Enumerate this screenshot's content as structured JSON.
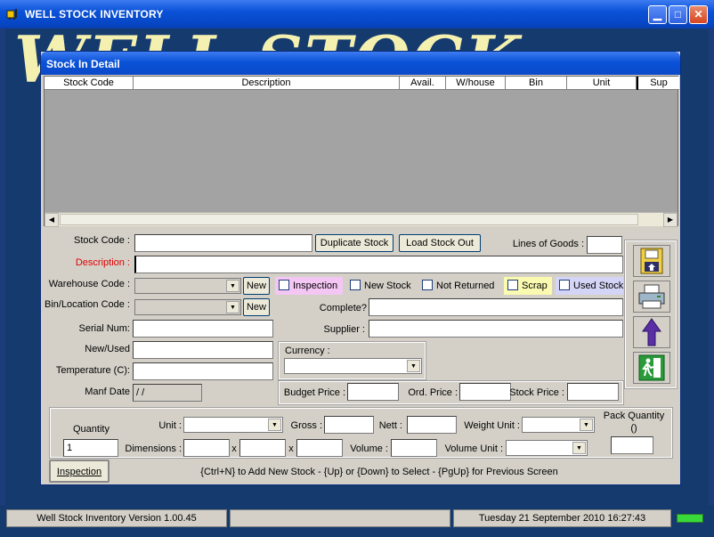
{
  "app": {
    "title": "WELL STOCK INVENTORY",
    "watermark": "WELL STOCK"
  },
  "window": {
    "title": "Stock In Detail"
  },
  "grid": {
    "columns": [
      "Stock Code",
      "Description",
      "Avail.",
      "W/house",
      "Bin",
      "Unit",
      "Sup"
    ]
  },
  "form": {
    "stock_code_label": "Stock Code :",
    "duplicate_stock_label": "Duplicate Stock",
    "load_stock_out_label": "Load Stock Out",
    "lines_of_goods_label": "Lines of Goods :",
    "description_label": "Description :",
    "warehouse_code_label": "Warehouse Code :",
    "new_label": "New",
    "bin_location_label": "Bin/Location Code :",
    "serial_num_label": "Serial Num:",
    "new_used_label": "New/Used",
    "temperature_label": "Temperature (C):",
    "manf_date_label": "Manf Date",
    "manf_date_value": " / /",
    "complete_label": "Complete?",
    "supplier_label": "Supplier :",
    "currency_label": "Currency :",
    "budget_price_label": "Budget Price :",
    "ord_price_label": "Ord. Price :",
    "stock_price_label": "Stock Price :",
    "checkboxes": {
      "inspection": "Inspection",
      "new_stock": "New Stock",
      "not_returned": "Not Returned",
      "scrap": "Scrap",
      "used_stock": "Used Stock"
    },
    "quantity_label": "Quantity",
    "quantity_value": "1",
    "unit_label": "Unit :",
    "gross_label": "Gross :",
    "nett_label": "Nett :",
    "weight_unit_label": "Weight Unit :",
    "pack_quantity_label": "Pack Quantity",
    "pack_quantity_sub": "()",
    "dimensions_label": "Dimensions :",
    "x_label": "x",
    "volume_label": "Volume :",
    "volume_unit_label": "Volume Unit :",
    "inspection_button_label": "Inspection",
    "hint": "{Ctrl+N} to Add New Stock - {Up} or {Down} to Select - {PgUp} for Previous Screen"
  },
  "colors": {
    "inspection": "#f4c6f4",
    "scrap": "#fafab0",
    "used_stock": "#d4d4f6",
    "description_label": "#e00000"
  },
  "toolbar": {
    "icons": [
      "save-icon",
      "print-icon",
      "up-arrow-icon",
      "exit-icon"
    ]
  },
  "status": {
    "version": "Well Stock Inventory  Version 1.00.45",
    "datetime": "Tuesday 21 September 2010  16:27:43"
  }
}
